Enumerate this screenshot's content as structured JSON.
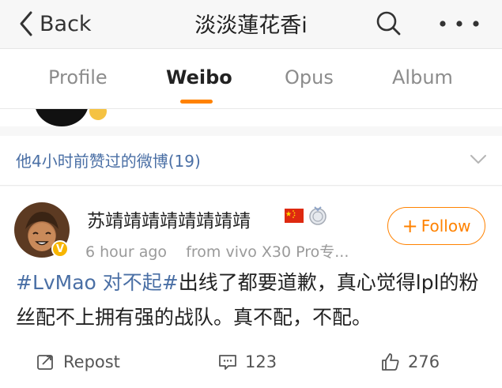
{
  "navbar": {
    "back_label": "Back",
    "title": "淡淡蓮花香i"
  },
  "tabs": [
    {
      "label": "Profile",
      "active": false
    },
    {
      "label": "Weibo",
      "active": true
    },
    {
      "label": "Opus",
      "active": false
    },
    {
      "label": "Album",
      "active": false
    }
  ],
  "liked_header": {
    "text": "他4小时前赞过的微博(19)"
  },
  "post": {
    "username": "苏靖靖靖靖靖靖靖靖",
    "verified_badge": "V",
    "time": "6 hour ago",
    "source": "from vivo X30 Pro专...",
    "follow_label": "Follow",
    "hashtag": "#LvMao 对不起#",
    "text_rest": "出线了都要道歉，真心觉得lpl的粉丝配不上拥有强的战队。真不配，不配。",
    "repost_label": "Repost",
    "comments": "123",
    "likes": "276"
  },
  "colors": {
    "accent": "#ff8200",
    "link": "#4a6fa5",
    "muted": "#9a9a9a"
  },
  "icons": [
    "chevron-left-icon",
    "search-icon",
    "more-icon",
    "chevron-down-icon",
    "china-flag-icon",
    "medal-icon",
    "repost-icon",
    "comment-icon",
    "like-icon"
  ]
}
